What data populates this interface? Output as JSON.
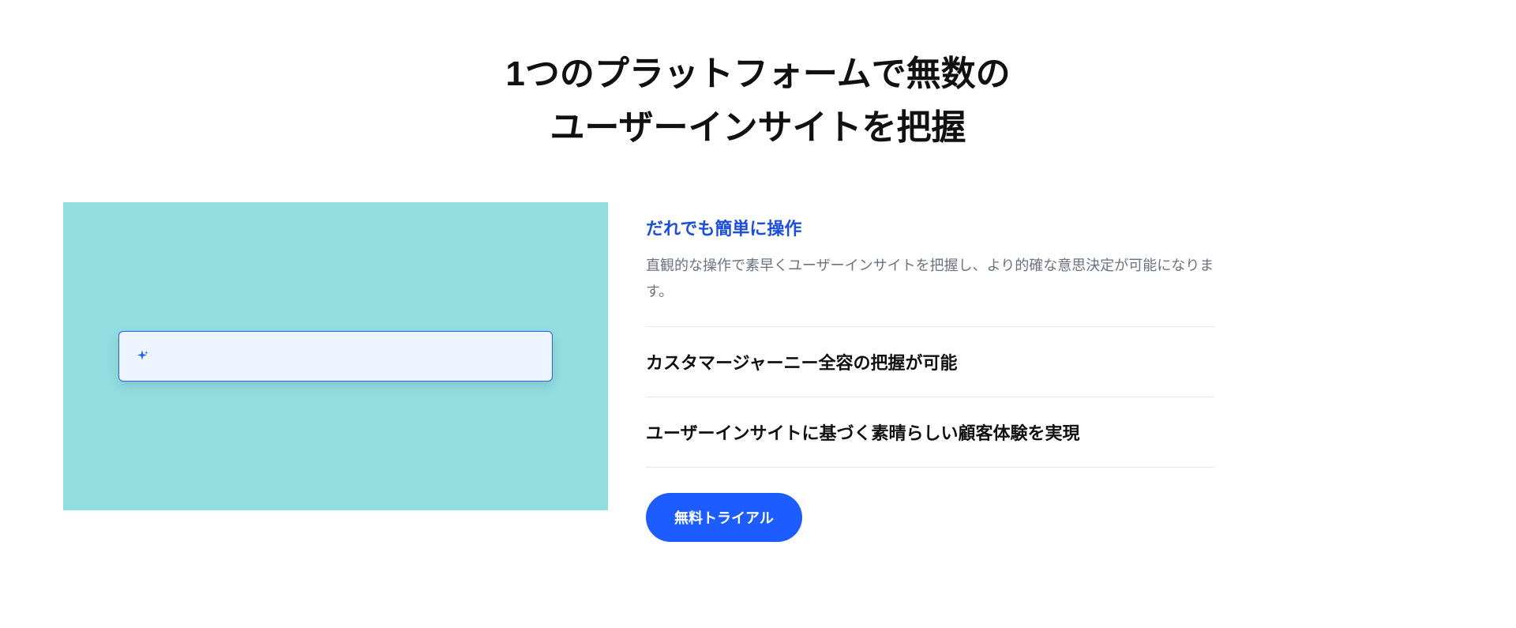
{
  "headline": {
    "line1": "1つのプラットフォームで無数の",
    "line2": "ユーザーインサイトを把握"
  },
  "accordion": {
    "items": [
      {
        "title": "だれでも簡単に操作",
        "body": "直観的な操作で素早くユーザーインサイトを把握し、より的確な意思決定が可能になります。",
        "expanded": true
      },
      {
        "title": "カスタマージャーニー全容の把握が可能",
        "body": "",
        "expanded": false
      },
      {
        "title": "ユーザーインサイトに基づく素晴らしい顧客体験を実現",
        "body": "",
        "expanded": false
      }
    ]
  },
  "cta": {
    "label": "無料トライアル"
  },
  "colors": {
    "accent_blue": "#1d4ed8",
    "button_blue": "#1d5cff",
    "panel_teal": "#91dde0",
    "searchbox_bg": "#edf3ff",
    "searchbox_border": "#2563eb",
    "body_text_muted": "#6b7280"
  },
  "icons": {
    "sparkle": "sparkle-icon"
  }
}
